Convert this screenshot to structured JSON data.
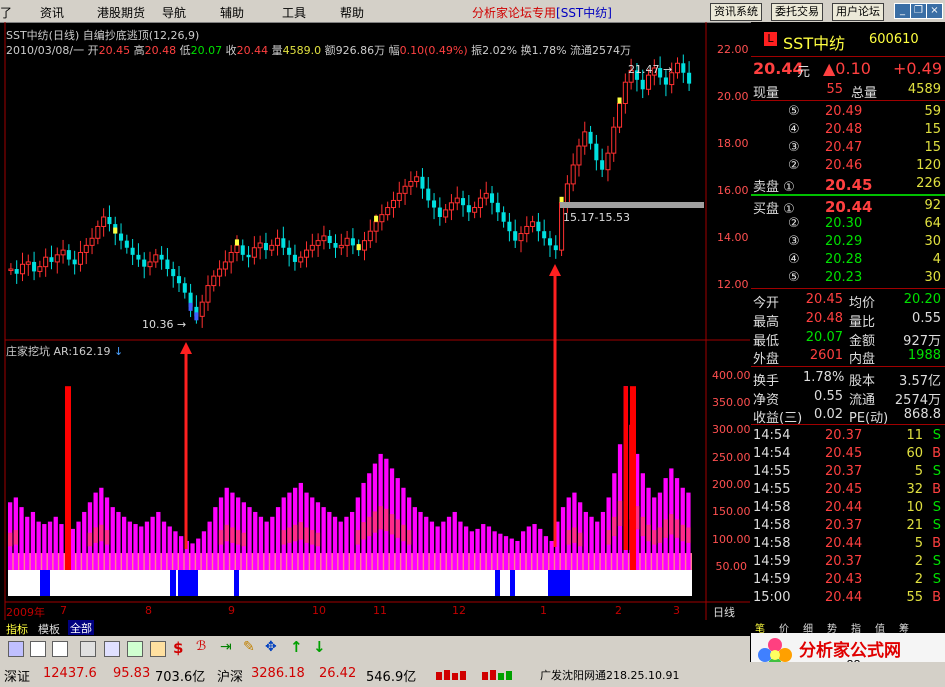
{
  "menu": {
    "items": [
      "资讯",
      "港股期货",
      "导航",
      "辅助",
      "工具",
      "帮助"
    ],
    "forum_text": "分析家论坛专用",
    "forum_stock": "[SST中纺]",
    "buttons": [
      "资讯系统",
      "委托交易",
      "用户论坛"
    ]
  },
  "chart": {
    "title_line": "SST中纺(日线) 自编抄底逃顶(12,26,9)",
    "date": "2010/03/08/一",
    "open_label": "开",
    "open": "20.45",
    "high_label": "高",
    "high": "20.48",
    "low_label": "低",
    "low": "20.07",
    "close_label": "收",
    "close": "20.44",
    "vol_label": "量",
    "vol": "4589.0",
    "amount_label": "额",
    "amount": "926.86万",
    "range_label": "幅",
    "range": "0.10(0.49%)",
    "swing_label": "振",
    "swing": "2.02%",
    "turnover_label": "换",
    "turnover": "1.78%",
    "float_label": "流通",
    "float": "2574万",
    "indicator_line": "庄家挖坑  AR:162.19",
    "annot_low": "10.36",
    "annot_high": "21.47",
    "annot_range": "15.17-15.53",
    "price_axis": [
      "22.00",
      "20.00",
      "18.00",
      "16.00",
      "14.00",
      "12.00"
    ],
    "ind_axis": [
      "400.00",
      "350.00",
      "300.00",
      "250.00",
      "200.00",
      "150.00",
      "100.00",
      "50.00"
    ],
    "months": [
      "2009年",
      "7",
      "8",
      "9",
      "10",
      "11",
      "12",
      "1",
      "2",
      "3"
    ],
    "period_label": "日线"
  },
  "chart_data": {
    "type": "candlestick+bar",
    "price": {
      "ylim": [
        10.36,
        22.2
      ],
      "low_point": 10.36,
      "high_point": 21.47,
      "gap_range": "15.17-15.53",
      "closes": [
        12.6,
        12.4,
        12.8,
        12.9,
        12.5,
        12.7,
        13.1,
        12.9,
        13.2,
        13.4,
        13.0,
        12.8,
        13.3,
        13.6,
        13.9,
        14.4,
        14.8,
        14.5,
        14.1,
        13.8,
        13.5,
        13.2,
        13.0,
        12.7,
        12.9,
        13.2,
        13.0,
        12.6,
        12.3,
        12.0,
        11.6,
        11.0,
        10.6,
        11.2,
        11.9,
        12.3,
        12.6,
        12.9,
        13.3,
        13.6,
        13.2,
        13.1,
        13.5,
        13.7,
        13.4,
        13.6,
        13.9,
        13.5,
        13.2,
        12.9,
        13.1,
        13.4,
        13.6,
        13.8,
        14.0,
        13.7,
        13.5,
        13.6,
        13.9,
        13.6,
        13.4,
        13.8,
        14.2,
        14.6,
        14.9,
        15.2,
        15.5,
        15.8,
        16.1,
        16.3,
        16.5,
        16.0,
        15.5,
        15.2,
        14.8,
        15.1,
        15.4,
        15.6,
        15.3,
        15.0,
        15.2,
        15.6,
        15.8,
        15.4,
        15.0,
        14.6,
        14.2,
        13.8,
        14.1,
        14.4,
        14.6,
        14.2,
        13.9,
        13.6,
        13.4,
        15.4,
        16.2,
        17.0,
        17.8,
        18.4,
        17.9,
        17.2,
        16.8,
        17.5,
        18.6,
        19.6,
        20.5,
        21.0,
        20.6,
        20.2,
        20.8,
        21.1,
        20.7,
        20.4,
        20.9,
        21.3,
        20.9,
        20.44
      ]
    },
    "indicator": {
      "name": "庄家挖坑",
      "AR": 162.19,
      "ylim": [
        0,
        430
      ],
      "values": [
        140,
        150,
        130,
        110,
        120,
        100,
        95,
        100,
        110,
        95,
        90,
        85,
        100,
        120,
        140,
        160,
        170,
        150,
        130,
        120,
        110,
        100,
        95,
        90,
        100,
        110,
        120,
        100,
        90,
        80,
        70,
        60,
        55,
        65,
        80,
        100,
        130,
        150,
        170,
        160,
        150,
        140,
        130,
        120,
        110,
        100,
        110,
        130,
        150,
        160,
        170,
        180,
        160,
        150,
        140,
        130,
        120,
        110,
        100,
        110,
        120,
        150,
        180,
        200,
        220,
        240,
        230,
        210,
        190,
        170,
        150,
        130,
        120,
        110,
        100,
        90,
        100,
        110,
        120,
        100,
        90,
        80,
        85,
        95,
        90,
        80,
        75,
        70,
        65,
        60,
        80,
        90,
        95,
        85,
        70,
        60,
        100,
        130,
        150,
        160,
        140,
        120,
        110,
        100,
        120,
        150,
        200,
        260,
        380,
        300,
        240,
        200,
        170,
        150,
        160,
        190,
        210,
        190,
        170,
        160
      ]
    }
  },
  "quote": {
    "stock_name": "SST中纺",
    "stock_code": "600610",
    "price": "20.44",
    "price_unit": "元",
    "change": "▲0.10",
    "change2": "+0.49",
    "now_label": "现量",
    "now_vol": "55",
    "total_label": "总量",
    "total_vol": "4589",
    "sell": [
      {
        "no": "⑤",
        "price": "20.49",
        "vol": "59"
      },
      {
        "no": "④",
        "price": "20.48",
        "vol": "15"
      },
      {
        "no": "③",
        "price": "20.47",
        "vol": "15"
      },
      {
        "no": "②",
        "price": "20.46",
        "vol": "120"
      },
      {
        "no": "卖盘 ①",
        "price": "20.45",
        "vol": "226"
      }
    ],
    "buy": [
      {
        "no": "买盘 ①",
        "price": "20.44",
        "vol": "92"
      },
      {
        "no": "②",
        "price": "20.30",
        "vol": "64"
      },
      {
        "no": "③",
        "price": "20.29",
        "vol": "30"
      },
      {
        "no": "④",
        "price": "20.28",
        "vol": "4"
      },
      {
        "no": "⑤",
        "price": "20.23",
        "vol": "30"
      }
    ],
    "stats": [
      {
        "l1": "今开",
        "v1": "20.45",
        "l2": "均价",
        "v2": "20.20"
      },
      {
        "l1": "最高",
        "v1": "20.48",
        "l2": "量比",
        "v2": "0.55"
      },
      {
        "l1": "最低",
        "v1": "20.07",
        "l2": "金额",
        "v2": "927万"
      },
      {
        "l1": "外盘",
        "v1": "2601",
        "l2": "内盘",
        "v2": "1988"
      }
    ],
    "fund": [
      {
        "l1": "换手",
        "v1": "1.78%",
        "l2": "股本",
        "v2": "3.57亿"
      },
      {
        "l1": "净资",
        "v1": "0.55",
        "l2": "流通",
        "v2": "2574万"
      },
      {
        "l1": "收益(三)",
        "v1": "0.02",
        "l2": "PE(动)",
        "v2": "868.8"
      }
    ],
    "ticks": [
      {
        "t": "14:54",
        "p": "20.37",
        "v": "11",
        "s": "S"
      },
      {
        "t": "14:54",
        "p": "20.45",
        "v": "60",
        "s": "B"
      },
      {
        "t": "14:55",
        "p": "20.37",
        "v": "5",
        "s": "S"
      },
      {
        "t": "14:55",
        "p": "20.45",
        "v": "32",
        "s": "B"
      },
      {
        "t": "14:58",
        "p": "20.44",
        "v": "10",
        "s": "S"
      },
      {
        "t": "14:58",
        "p": "20.37",
        "v": "21",
        "s": "S"
      },
      {
        "t": "14:58",
        "p": "20.44",
        "v": "5",
        "s": "B"
      },
      {
        "t": "14:59",
        "p": "20.37",
        "v": "2",
        "s": "S"
      },
      {
        "t": "14:59",
        "p": "20.43",
        "v": "2",
        "s": "S"
      },
      {
        "t": "15:00",
        "p": "20.44",
        "v": "55",
        "s": "B"
      }
    ],
    "bottom_tabs": [
      "笔",
      "价",
      "细",
      "势",
      "指",
      "值",
      "筹"
    ]
  },
  "tabs": [
    "指标",
    "模板",
    "全部"
  ],
  "status": {
    "sz_label": "深证",
    "sz_index": "12437.6",
    "sz_change": "95.83",
    "sz_amount": "703.6亿",
    "hs_label": "沪深",
    "hs_index": "3286.18",
    "hs_change": "26.42",
    "hs_amount": "546.9亿",
    "server": "广发沈阳网通218.25.10.91"
  },
  "logo": {
    "text": "分析家公式网",
    "url": "www.88gs.com"
  },
  "colors": {
    "up": "#ff4040",
    "down": "#00e000",
    "ind_magenta": "#ff00ff",
    "ind_red": "#ff0000",
    "ind_pink": "#ff6090",
    "ind_blue": "#0000ff"
  }
}
